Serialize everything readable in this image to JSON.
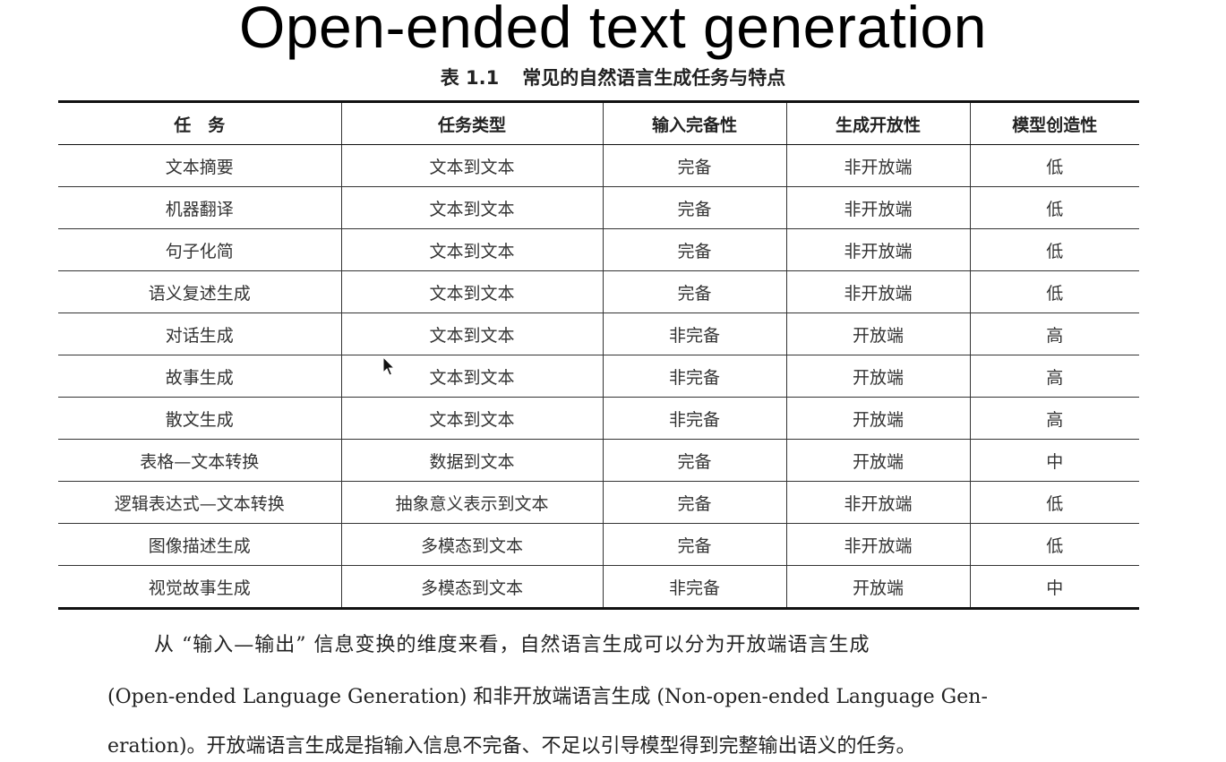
{
  "slide_title": "Open-ended text generation",
  "table": {
    "caption_number": "表 1.1",
    "caption_title": "常见的自然语言生成任务与特点",
    "headers": [
      "任　务",
      "任务类型",
      "输入完备性",
      "生成开放性",
      "模型创造性"
    ],
    "rows": [
      [
        "文本摘要",
        "文本到文本",
        "完备",
        "非开放端",
        "低"
      ],
      [
        "机器翻译",
        "文本到文本",
        "完备",
        "非开放端",
        "低"
      ],
      [
        "句子化简",
        "文本到文本",
        "完备",
        "非开放端",
        "低"
      ],
      [
        "语义复述生成",
        "文本到文本",
        "完备",
        "非开放端",
        "低"
      ],
      [
        "对话生成",
        "文本到文本",
        "非完备",
        "开放端",
        "高"
      ],
      [
        "故事生成",
        "文本到文本",
        "非完备",
        "开放端",
        "高"
      ],
      [
        "散文生成",
        "文本到文本",
        "非完备",
        "开放端",
        "高"
      ],
      [
        "表格—文本转换",
        "数据到文本",
        "完备",
        "开放端",
        "中"
      ],
      [
        "逻辑表达式—文本转换",
        "抽象意义表示到文本",
        "完备",
        "非开放端",
        "低"
      ],
      [
        "图像描述生成",
        "多模态到文本",
        "完备",
        "非开放端",
        "低"
      ],
      [
        "视觉故事生成",
        "多模态到文本",
        "非完备",
        "开放端",
        "中"
      ]
    ]
  },
  "body_text": {
    "line1": "从 “输入—输出” 信息变换的维度来看，自然语言生成可以分为开放端语言生成",
    "line2": "(Open-ended Language Generation) 和非开放端语言生成 (Non-open-ended Language Gen-",
    "line3": "eration)。开放端语言生成是指输入信息不完备、不足以引导模型得到完整输出语义的任务。"
  },
  "cursor_icon": "mouse-pointer-icon"
}
